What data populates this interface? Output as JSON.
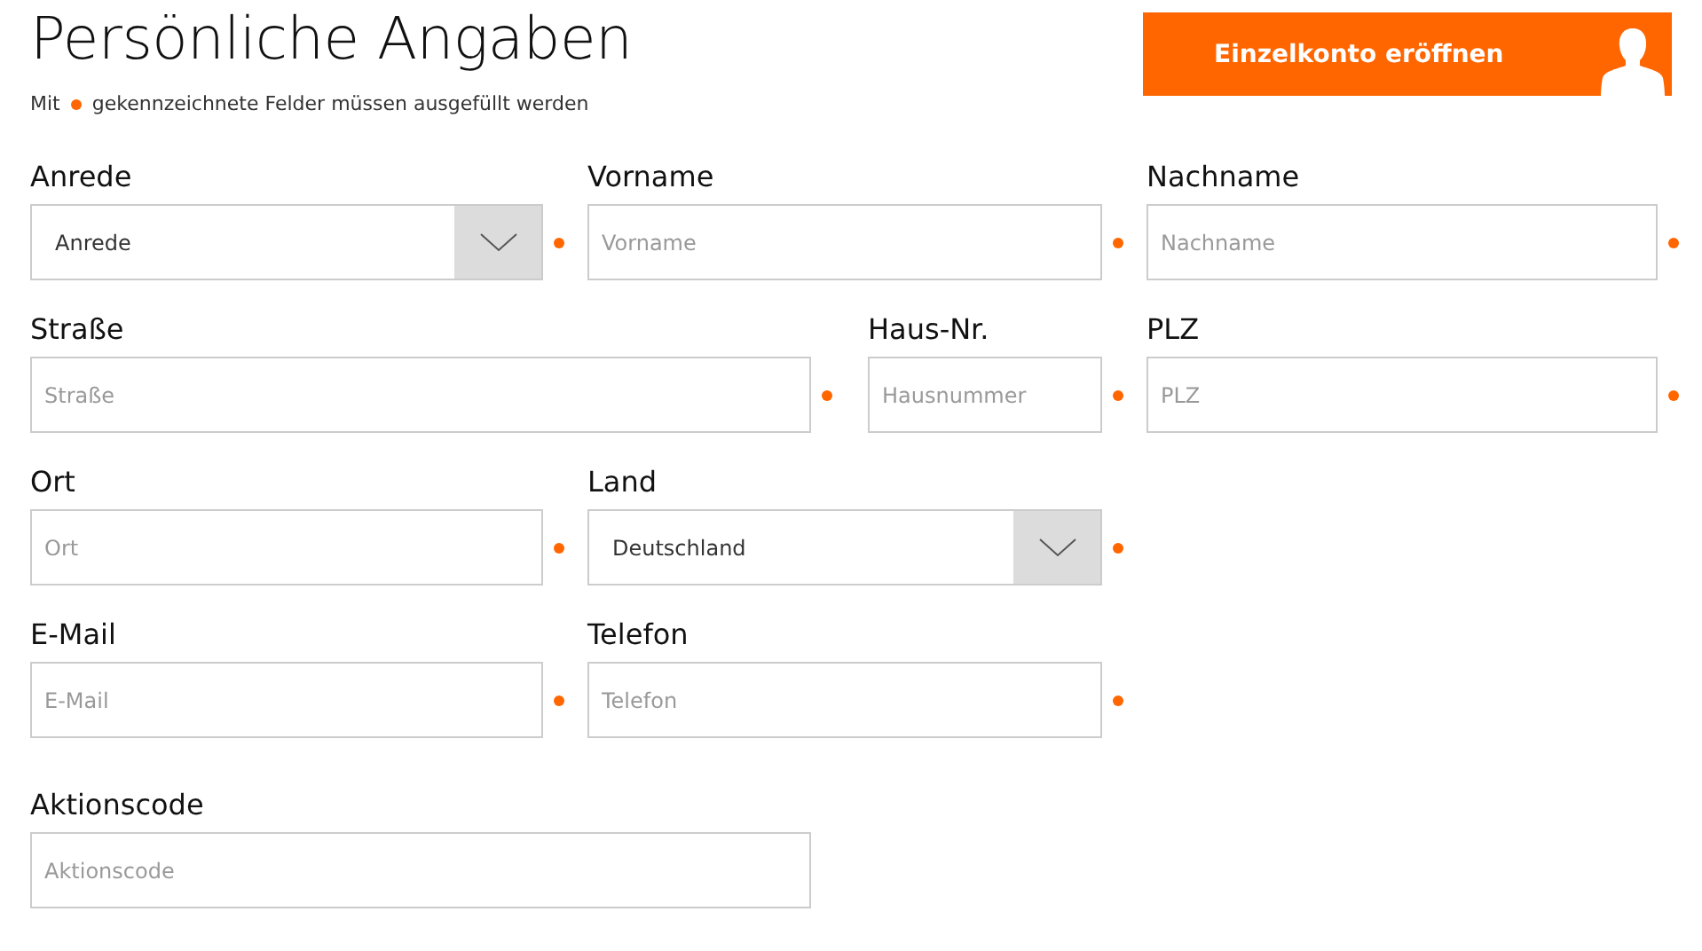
{
  "title": "Persönliche Angaben",
  "note": {
    "before": "Mit",
    "after": "gekennzeichnete Felder müssen ausgefüllt werden"
  },
  "open_button": {
    "label": "Einzelkonto eröffnen"
  },
  "rows": [
    {
      "fields": [
        {
          "label": "Anrede",
          "kind": "select",
          "value": "Anrede",
          "required": true
        },
        {
          "label": "Vorname",
          "kind": "text",
          "placeholder": "Vorname",
          "required": true
        },
        {
          "label": "Nachname",
          "kind": "text",
          "placeholder": "Nachname",
          "required": true
        }
      ]
    },
    {
      "fields": [
        {
          "label": "Straße",
          "kind": "text",
          "placeholder": "Straße",
          "required": true
        },
        {
          "label": "Haus-Nr.",
          "kind": "text",
          "placeholder": "Hausnummer",
          "required": true
        },
        {
          "label": "PLZ",
          "kind": "text",
          "placeholder": "PLZ",
          "required": true
        }
      ]
    },
    {
      "fields": [
        {
          "label": "Ort",
          "kind": "text",
          "placeholder": "Ort",
          "required": true
        },
        {
          "label": "Land",
          "kind": "select",
          "value": "Deutschland",
          "required": true
        }
      ]
    },
    {
      "fields": [
        {
          "label": "E-Mail",
          "kind": "text",
          "placeholder": "E-Mail",
          "required": true
        },
        {
          "label": "Telefon",
          "kind": "text",
          "placeholder": "Telefon",
          "required": true
        }
      ]
    },
    {
      "fields": [
        {
          "label": "Aktionscode",
          "kind": "text",
          "placeholder": "Aktionscode",
          "required": false
        }
      ]
    }
  ]
}
